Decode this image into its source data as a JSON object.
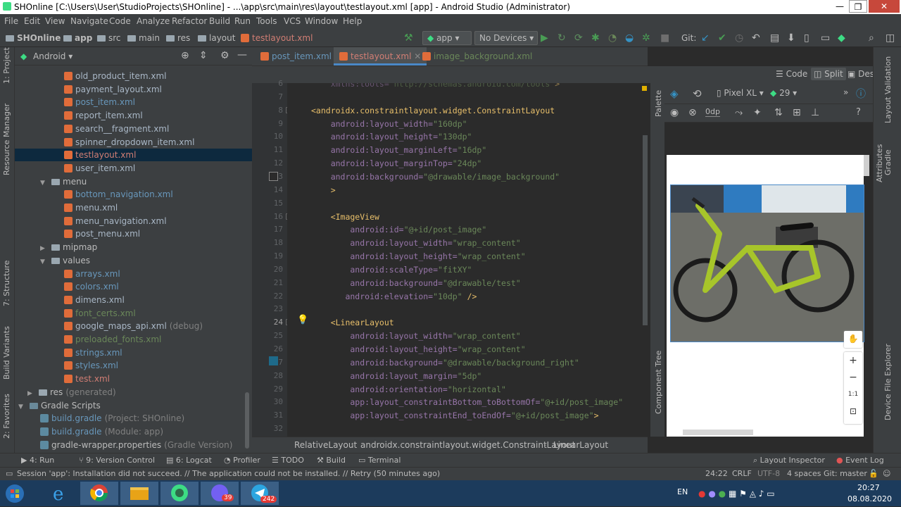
{
  "window": {
    "title": "SHOnline [C:\\Users\\User\\StudioProjects\\SHOnline] - ...\\app\\src\\main\\res\\layout\\testlayout.xml [app] - Android Studio (Administrator)",
    "min": "—",
    "max": "❐",
    "close": "✕"
  },
  "menu": [
    "File",
    "Edit",
    "View",
    "Navigate",
    "Code",
    "Analyze",
    "Refactor",
    "Build",
    "Run",
    "Tools",
    "VCS",
    "Window",
    "Help"
  ],
  "nav": {
    "crumbs": [
      "SHOnline",
      "app",
      "src",
      "main",
      "res",
      "layout",
      "testlayout.xml"
    ],
    "config": "app",
    "device": "No Devices",
    "git_label": "Git:"
  },
  "project": {
    "view": "Android",
    "items": [
      {
        "label": "old_product_item.xml",
        "kind": "xml",
        "color": "#a9b7c6"
      },
      {
        "label": "payment_layout.xml",
        "kind": "xml",
        "color": "#a9b7c6"
      },
      {
        "label": "post_item.xml",
        "kind": "xml",
        "color": "#6897bb"
      },
      {
        "label": "report_item.xml",
        "kind": "xml",
        "color": "#a9b7c6"
      },
      {
        "label": "search__fragment.xml",
        "kind": "xml",
        "color": "#a9b7c6"
      },
      {
        "label": "spinner_dropdown_item.xml",
        "kind": "xml",
        "color": "#a9b7c6"
      },
      {
        "label": "testlayout.xml",
        "kind": "xml",
        "color": "#d27e74"
      },
      {
        "label": "user_item.xml",
        "kind": "xml",
        "color": "#a9b7c6"
      },
      {
        "label": "menu",
        "kind": "folder",
        "color": "#bbbbbb"
      },
      {
        "label": "bottom_navigation.xml",
        "kind": "xml",
        "color": "#6897bb"
      },
      {
        "label": "menu.xml",
        "kind": "xml",
        "color": "#a9b7c6"
      },
      {
        "label": "menu_navigation.xml",
        "kind": "xml",
        "color": "#a9b7c6"
      },
      {
        "label": "post_menu.xml",
        "kind": "xml",
        "color": "#a9b7c6"
      },
      {
        "label": "mipmap",
        "kind": "folder",
        "color": "#bbbbbb"
      },
      {
        "label": "values",
        "kind": "folder",
        "color": "#bbbbbb"
      },
      {
        "label": "arrays.xml",
        "kind": "xml",
        "color": "#6897bb"
      },
      {
        "label": "colors.xml",
        "kind": "xml",
        "color": "#6897bb"
      },
      {
        "label": "dimens.xml",
        "kind": "xml",
        "color": "#a9b7c6"
      },
      {
        "label": "font_certs.xml",
        "kind": "xml",
        "color": "#6a8759"
      },
      {
        "label": "google_maps_api.xml",
        "kind": "xml",
        "color": "#a9b7c6",
        "suffix": "(debug)"
      },
      {
        "label": "preloaded_fonts.xml",
        "kind": "xml",
        "color": "#6a8759"
      },
      {
        "label": "strings.xml",
        "kind": "xml",
        "color": "#6897bb"
      },
      {
        "label": "styles.xml",
        "kind": "xml",
        "color": "#6897bb"
      },
      {
        "label": "test.xml",
        "kind": "xml",
        "color": "#d27e74"
      },
      {
        "label": "res",
        "kind": "folder",
        "color": "#bbbbbb",
        "suffix": "(generated)"
      },
      {
        "label": "Gradle Scripts",
        "kind": "gradle",
        "color": "#bbbbbb"
      },
      {
        "label": "build.gradle",
        "kind": "gradlefile",
        "color": "#6897bb",
        "suffix": "(Project: SHOnline)"
      },
      {
        "label": "build.gradle",
        "kind": "gradlefile",
        "color": "#6897bb",
        "suffix": "(Module: app)"
      },
      {
        "label": "gradle-wrapper.properties",
        "kind": "gradlefile",
        "color": "#bbbbbb",
        "suffix": "(Gradle Version)"
      }
    ]
  },
  "tabs": [
    "post_item.xml",
    "testlayout.xml",
    "image_background.xml"
  ],
  "modes": {
    "code": "Code",
    "split": "Split",
    "design": "Design"
  },
  "gutter": [
    "6",
    "7",
    "8",
    "9",
    "10",
    "11",
    "12",
    "13",
    "14",
    "15",
    "16",
    "17",
    "18",
    "19",
    "20",
    "21",
    "22",
    "23",
    "24",
    "25",
    "26",
    "27",
    "28",
    "29",
    "30",
    "31",
    "32"
  ],
  "code": [
    [
      [
        "attr",
        "    xmlns:tools="
      ],
      [
        "val",
        "\"http://schemas.android.com/tools\""
      ],
      [
        "tag",
        ">"
      ]
    ],
    [
      [
        "plain",
        ""
      ]
    ],
    [
      [
        "tag",
        "<androidx.constraintlayout.widget.ConstraintLayout"
      ]
    ],
    [
      [
        "ns",
        "    android:layout_width="
      ],
      [
        "val",
        "\"160dp\""
      ]
    ],
    [
      [
        "ns",
        "    android:layout_height="
      ],
      [
        "val",
        "\"130dp\""
      ]
    ],
    [
      [
        "ns",
        "    android:layout_marginLeft="
      ],
      [
        "val",
        "\"16dp\""
      ]
    ],
    [
      [
        "ns",
        "    android:layout_marginTop="
      ],
      [
        "val",
        "\"24dp\""
      ]
    ],
    [
      [
        "ns",
        "    android:background="
      ],
      [
        "val",
        "\"@drawable/image_background\""
      ]
    ],
    [
      [
        "tag",
        "    >"
      ]
    ],
    [
      [
        "plain",
        ""
      ]
    ],
    [
      [
        "tag",
        "    <ImageView"
      ]
    ],
    [
      [
        "ns",
        "        android:id="
      ],
      [
        "val",
        "\"@+id/post_image\""
      ]
    ],
    [
      [
        "ns",
        "        android:layout_width="
      ],
      [
        "val",
        "\"wrap_content\""
      ]
    ],
    [
      [
        "ns",
        "        android:layout_height="
      ],
      [
        "val",
        "\"wrap_content\""
      ]
    ],
    [
      [
        "ns",
        "        android:scaleType="
      ],
      [
        "val",
        "\"fitXY\""
      ]
    ],
    [
      [
        "ns",
        "        android:background="
      ],
      [
        "val",
        "\"@drawable/test\""
      ]
    ],
    [
      [
        "ns",
        "       android:elevation="
      ],
      [
        "val",
        "\"10dp\""
      ],
      [
        "tag",
        " />"
      ]
    ],
    [
      [
        "plain",
        ""
      ]
    ],
    [
      [
        "tag",
        "    <LinearLayout"
      ]
    ],
    [
      [
        "ns",
        "        android:layout_width="
      ],
      [
        "val",
        "\"wrap_content\""
      ]
    ],
    [
      [
        "ns",
        "        android:layout_height="
      ],
      [
        "val",
        "\"wrap_content\""
      ]
    ],
    [
      [
        "ns",
        "        android:background="
      ],
      [
        "val",
        "\"@drawable/background_right\""
      ]
    ],
    [
      [
        "ns",
        "        android:layout_margin="
      ],
      [
        "val",
        "\"5dp\""
      ]
    ],
    [
      [
        "ns",
        "        android:orientation="
      ],
      [
        "val",
        "\"horizontal\""
      ]
    ],
    [
      [
        "ns",
        "        app:layout_constraintBottom_toBottomOf="
      ],
      [
        "val",
        "\"@+id/post_image\""
      ]
    ],
    [
      [
        "ns",
        "        app:layout_constraintEnd_toEndOf="
      ],
      [
        "val",
        "\"@+id/post_image\""
      ],
      [
        "tag",
        ">"
      ]
    ],
    [
      [
        "plain",
        ""
      ]
    ]
  ],
  "breadcrumbs": [
    "RelativeLayout",
    "androidx.constraintlayout.widget.ConstraintLayout",
    "LinearLayout"
  ],
  "design": {
    "device": "Pixel XL",
    "api": "29",
    "dp": "0dp",
    "zoom_in": "+",
    "zoom_out": "−",
    "one_to_one": "1:1",
    "palette": "Palette",
    "component_tree": "Component Tree"
  },
  "left_tools": [
    "1: Project",
    "Resource Manager",
    "7: Structure",
    "Build Variants",
    "2: Favorites"
  ],
  "right_tools": [
    "Layout Validation",
    "Attributes",
    "Gradle",
    "Device File Explorer"
  ],
  "bottom_tools": [
    "4: Run",
    "9: Version Control",
    "6: Logcat",
    "Profiler",
    "TODO",
    "Build",
    "Terminal"
  ],
  "bottom_right_tools": [
    "Layout Inspector",
    "Event Log"
  ],
  "status": {
    "message": "Session 'app': Installation did not succeed. // The application could not be installed. // Retry (50 minutes ago)",
    "position": "24:22",
    "line_sep": "CRLF",
    "encoding": "UTF-8",
    "indent": "4 spaces",
    "branch": "Git: master"
  },
  "taskbar": {
    "lang": "EN",
    "time": "20:27",
    "date": "08.08.2020",
    "viber_badge": "39",
    "telegram_badge": "242"
  },
  "colors": {
    "accent": "#3592c4",
    "run": "#499c54",
    "bg": "#2b2b2b",
    "panel": "#3c3f41"
  }
}
